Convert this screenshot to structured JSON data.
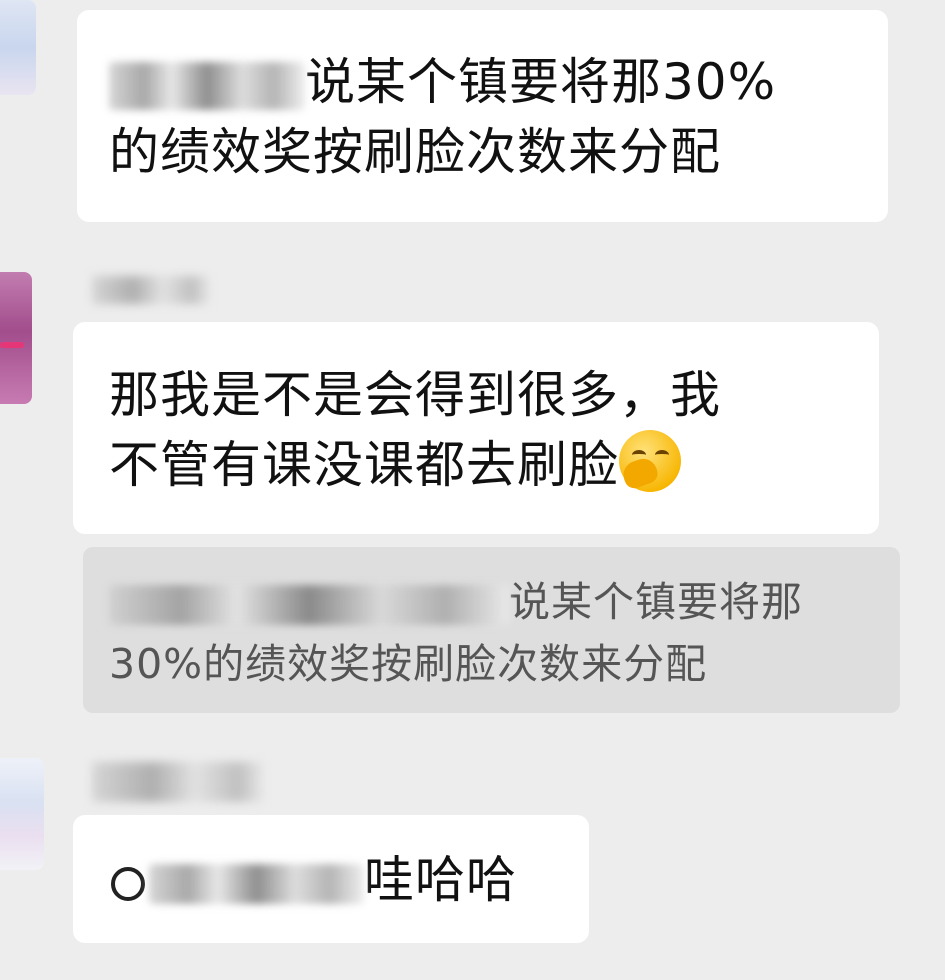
{
  "messages": [
    {
      "sender_name": "",
      "text_line1": "说某个镇要将那30%",
      "text_line2": "的绩效奖按刷脸次数来分配"
    },
    {
      "sender_name": "",
      "text_line1": "那我是不是会得到很多，我",
      "text_line2": "不管有课没课都去刷脸",
      "emoji": "hand-over-mouth-emoji",
      "quote": {
        "line1": "说某个镇要将那",
        "line2": "30%的绩效奖按刷脸次数来分配"
      }
    },
    {
      "sender_name": "",
      "mention_symbol": "@",
      "text": "哇哈哈"
    }
  ],
  "colors": {
    "background": "#ededed",
    "bubble": "#ffffff",
    "quote_bg": "#dedede",
    "quote_text": "#555555"
  }
}
